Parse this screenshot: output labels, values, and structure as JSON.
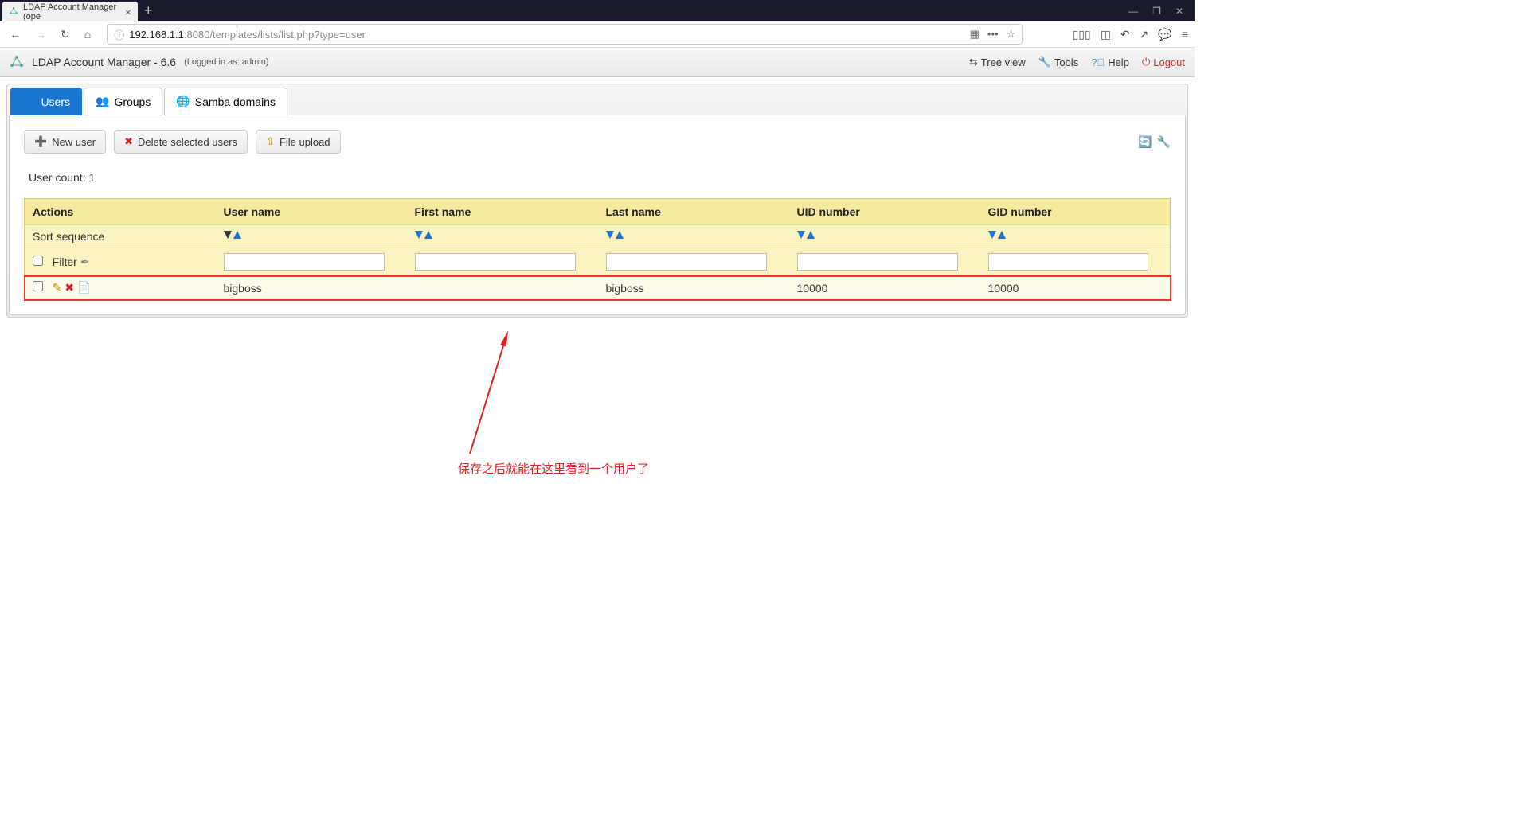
{
  "browser": {
    "tab_title": "LDAP Account Manager (ope",
    "url_host": "192.168.1.1",
    "url_path": ":8080/templates/lists/list.php?type=user"
  },
  "header": {
    "app_title": "LDAP Account Manager - 6.6",
    "login_info": "(Logged in as: admin)",
    "menu": {
      "treeview": "Tree view",
      "tools": "Tools",
      "help": "Help",
      "logout": "Logout"
    }
  },
  "tabs": {
    "users": "Users",
    "groups": "Groups",
    "samba": "Samba domains"
  },
  "actions": {
    "new_user": "New user",
    "delete_selected": "Delete selected users",
    "file_upload": "File upload"
  },
  "count_label": "User count: 1",
  "table": {
    "headers": {
      "actions": "Actions",
      "username": "User name",
      "firstname": "First name",
      "lastname": "Last name",
      "uid": "UID number",
      "gid": "GID number"
    },
    "sort_label": "Sort sequence",
    "filter_label": "Filter",
    "rows": [
      {
        "username": "bigboss",
        "firstname": "",
        "lastname": "bigboss",
        "uid": "10000",
        "gid": "10000"
      }
    ]
  },
  "annotation": "保存之后就能在这里看到一个用户了"
}
